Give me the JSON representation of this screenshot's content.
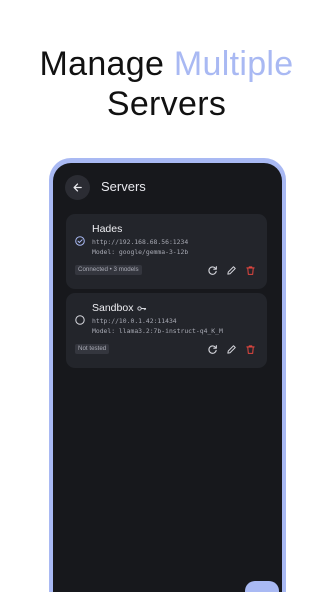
{
  "headline": {
    "part1": "Manage ",
    "accent": "Multiple",
    "line2": "Servers"
  },
  "app": {
    "title": "Servers"
  },
  "servers": [
    {
      "name": "Hades",
      "url": "http://192.168.68.56:1234",
      "model": "Model: google/gemma-3-12b",
      "status": "Connected • 3 models",
      "selected": true,
      "has_key": false
    },
    {
      "name": "Sandbox",
      "url": "http://10.0.1.42:11434",
      "model": "Model: llama3.2:7b-instruct-q4_K_M",
      "status": "Not tested",
      "selected": false,
      "has_key": true
    }
  ],
  "icons": {
    "back": "arrow-left-icon",
    "selected": "check-circle-icon",
    "unselected": "radio-empty-icon",
    "key": "key-icon",
    "refresh": "refresh-icon",
    "edit": "pencil-icon",
    "delete": "trash-icon"
  },
  "colors": {
    "accent": "#a9b9f3",
    "screen_bg": "#17181c",
    "card_bg": "#23252b",
    "delete": "#e0463f"
  }
}
